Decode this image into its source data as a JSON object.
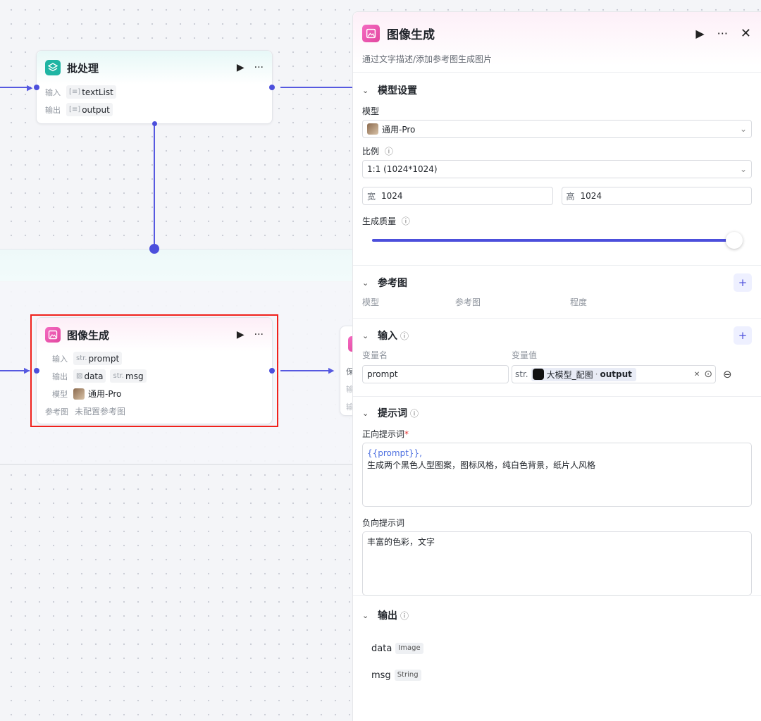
{
  "batch_node": {
    "title": "批处理",
    "input_key": "输入",
    "input_value": "textList",
    "output_key": "输出",
    "output_value": "output"
  },
  "image_node": {
    "title": "图像生成",
    "input_key": "输入",
    "input_prefix": "str.",
    "input_value": "prompt",
    "output_key": "输出",
    "output_value1": "data",
    "output_prefix2": "str.",
    "output_value2": "msg",
    "model_key": "模型",
    "model_value": "通用-Pro",
    "ref_key": "参考图",
    "ref_value": "未配置参考图"
  },
  "side_node": {
    "rows": [
      "保",
      "输",
      "输"
    ]
  },
  "panel": {
    "title": "图像生成",
    "description": "通过文字描述/添加参考图生成图片",
    "model_settings": {
      "heading": "模型设置",
      "model_label": "模型",
      "model_value": "通用-Pro",
      "ratio_label": "比例",
      "ratio_value": "1:1 (1024*1024)",
      "width_prefix": "宽",
      "width_value": "1024",
      "height_prefix": "高",
      "height_value": "1024",
      "quality_label": "生成质量",
      "quality_fraction": 1.0
    },
    "reference": {
      "heading": "参考图",
      "columns": [
        "模型",
        "参考图",
        "程度"
      ]
    },
    "input": {
      "heading": "输入",
      "col_name": "变量名",
      "col_value": "变量值",
      "var_name": "prompt",
      "var_type": "str.",
      "var_source": "大模型_配图",
      "var_field": "output"
    },
    "prompt": {
      "heading": "提示词",
      "positive_label": "正向提示词",
      "required_mark": "*",
      "positive_var": "{{prompt}},",
      "positive_text": "生成两个黑色人型图案，图标风格，纯白色背景，纸片人风格",
      "negative_label": "负向提示词",
      "negative_text": "丰富的色彩，文字"
    },
    "output": {
      "heading": "输出",
      "items": [
        {
          "name": "data",
          "type": "Image"
        },
        {
          "name": "msg",
          "type": "String"
        }
      ]
    }
  },
  "colors": {
    "accent": "#4c4fdc",
    "selection": "#f0211b",
    "node_pink": "#e8489f",
    "node_teal": "#1fb5a3"
  }
}
